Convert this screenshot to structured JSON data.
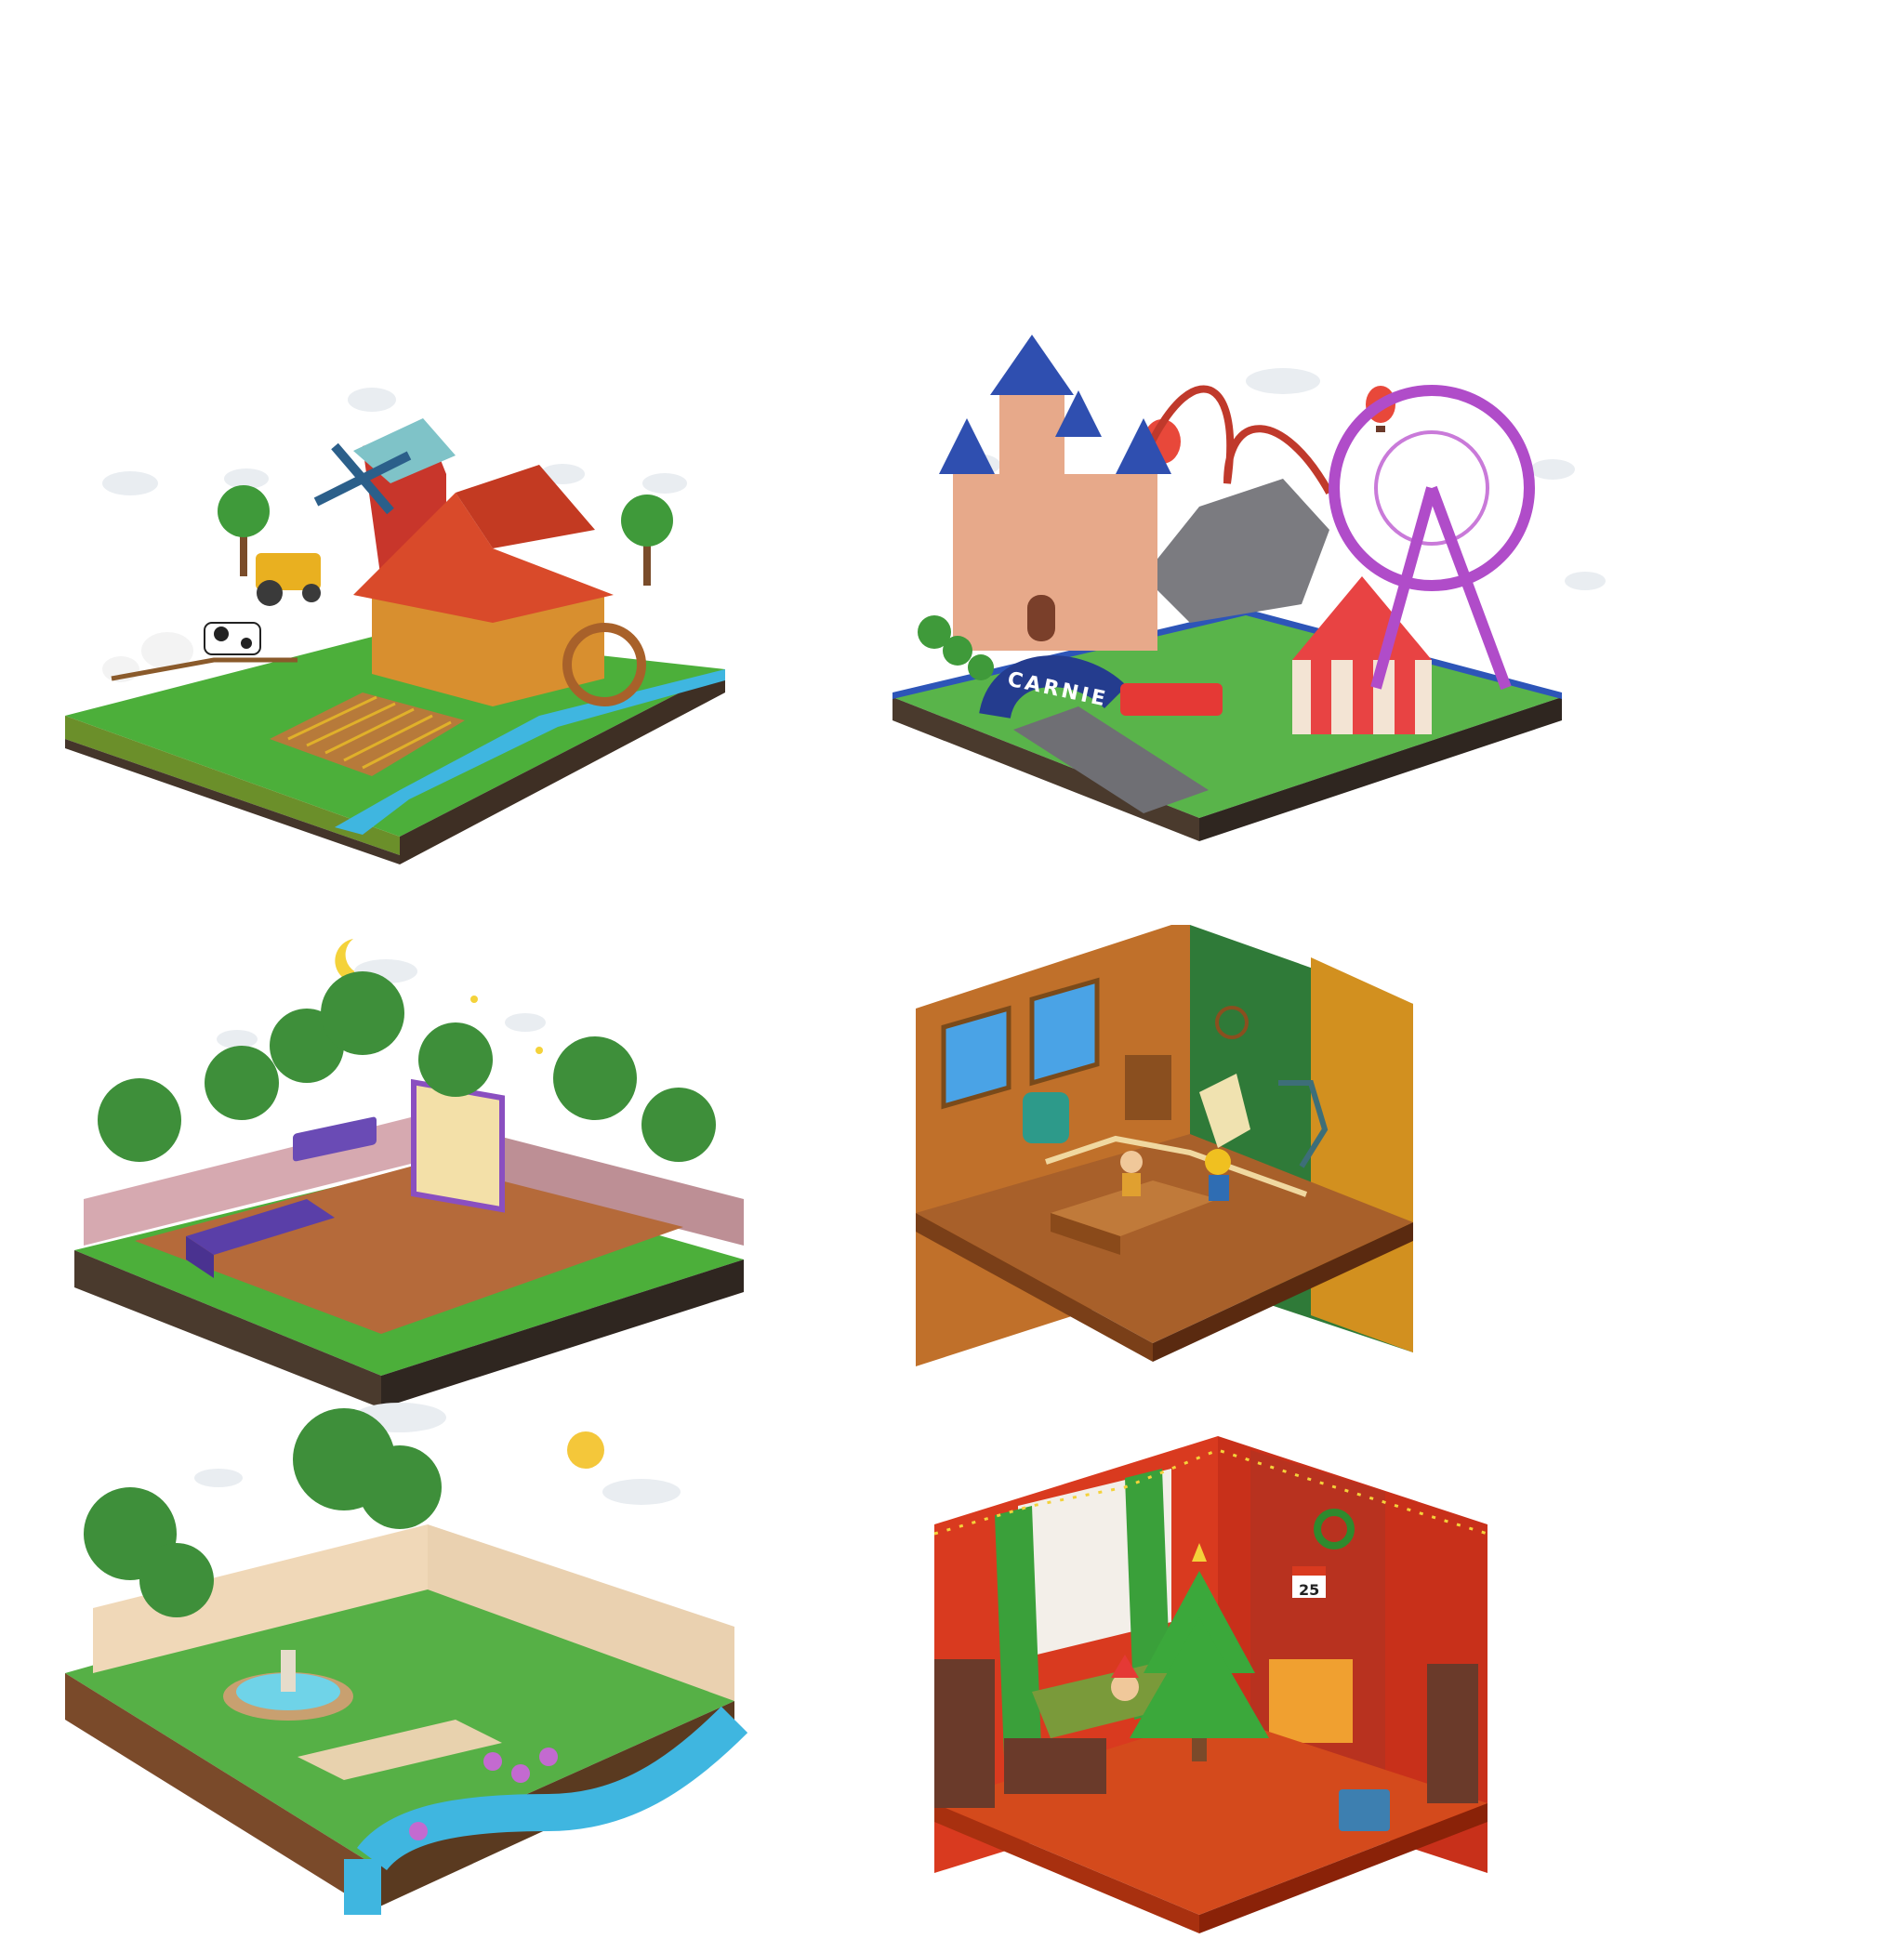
{
  "grid": {
    "columns": 2,
    "rows": 3
  },
  "scenes": [
    {
      "name": "farm",
      "theme": "farm",
      "signs": []
    },
    {
      "name": "amusement-park",
      "theme": "carnival",
      "signs": [
        "CARNIE"
      ]
    },
    {
      "name": "night-cinema",
      "theme": "backyard movie night",
      "signs": []
    },
    {
      "name": "toy-workshop",
      "theme": "wood workshop interior",
      "signs": []
    },
    {
      "name": "park-garden",
      "theme": "garden with fountain",
      "signs": []
    },
    {
      "name": "christmas-room",
      "theme": "christmas living room",
      "signs": [
        "25"
      ]
    }
  ],
  "colors": {
    "background": "#ffffff",
    "grass": "#4caf3a",
    "soil": "#5a4232",
    "water": "#3fb6e0",
    "barn_red": "#c8362b",
    "castle": "#e7a98a",
    "coaster": "#c0392b",
    "ferris": "#b04cc9",
    "workshop_wood": "#c0702a",
    "christmas_wall": "#d93a1f"
  }
}
